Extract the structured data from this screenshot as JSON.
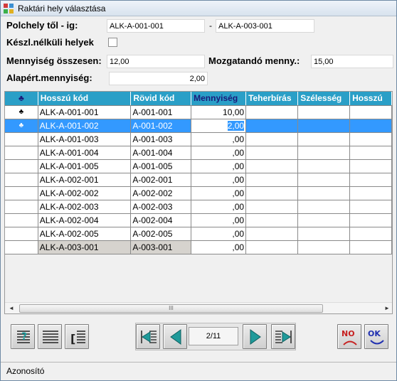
{
  "window": {
    "title": "Raktári hely választása"
  },
  "form": {
    "polchely_label": "Polchely től - ig:",
    "polchely_from": "ALK-A-001-001",
    "dash": "-",
    "polchely_to": "ALK-A-003-001",
    "keszl_label": "Készl.nélküli helyek",
    "menny_osszesen_label": "Mennyiség összesen:",
    "menny_osszesen_value": "12,00",
    "mozgatando_label": "Mozgatandó menny.:",
    "mozgatando_value": "15,00",
    "alapert_label": "Alapért.mennyiség:",
    "alapert_value": "2,00"
  },
  "grid": {
    "indicator_header": "♣",
    "columns": [
      "Hosszú kód",
      "Rövid kód",
      "Mennyiség",
      "Teherbírás",
      "Szélesség",
      "Hosszú"
    ],
    "rows": [
      {
        "ind": "♣",
        "long": "ALK-A-001-001",
        "short": "A-001-001",
        "qty": "10,00"
      },
      {
        "ind": "♣",
        "long": "ALK-A-001-002",
        "short": "A-001-002",
        "qty": "2,00"
      },
      {
        "ind": "",
        "long": "ALK-A-001-003",
        "short": "A-001-003",
        "qty": ",00"
      },
      {
        "ind": "",
        "long": "ALK-A-001-004",
        "short": "A-001-004",
        "qty": ",00"
      },
      {
        "ind": "",
        "long": "ALK-A-001-005",
        "short": "A-001-005",
        "qty": ",00"
      },
      {
        "ind": "",
        "long": "ALK-A-002-001",
        "short": "A-002-001",
        "qty": ",00"
      },
      {
        "ind": "",
        "long": "ALK-A-002-002",
        "short": "A-002-002",
        "qty": ",00"
      },
      {
        "ind": "",
        "long": "ALK-A-002-003",
        "short": "A-002-003",
        "qty": ",00"
      },
      {
        "ind": "",
        "long": "ALK-A-002-004",
        "short": "A-002-004",
        "qty": ",00"
      },
      {
        "ind": "",
        "long": "ALK-A-002-005",
        "short": "A-002-005",
        "qty": ",00"
      },
      {
        "ind": "",
        "long": "ALK-A-003-001",
        "short": "A-003-001",
        "qty": ",00"
      }
    ],
    "scroll_thumb": "III"
  },
  "toolbar": {
    "page_indicator": "2/11",
    "no_label": "NO",
    "ok_label": "OK"
  },
  "status": {
    "text": "Azonosító"
  },
  "colors": {
    "header_bg": "#2a9fc7",
    "selection": "#3399ff",
    "nav_arrow": "#1f9a9a"
  }
}
